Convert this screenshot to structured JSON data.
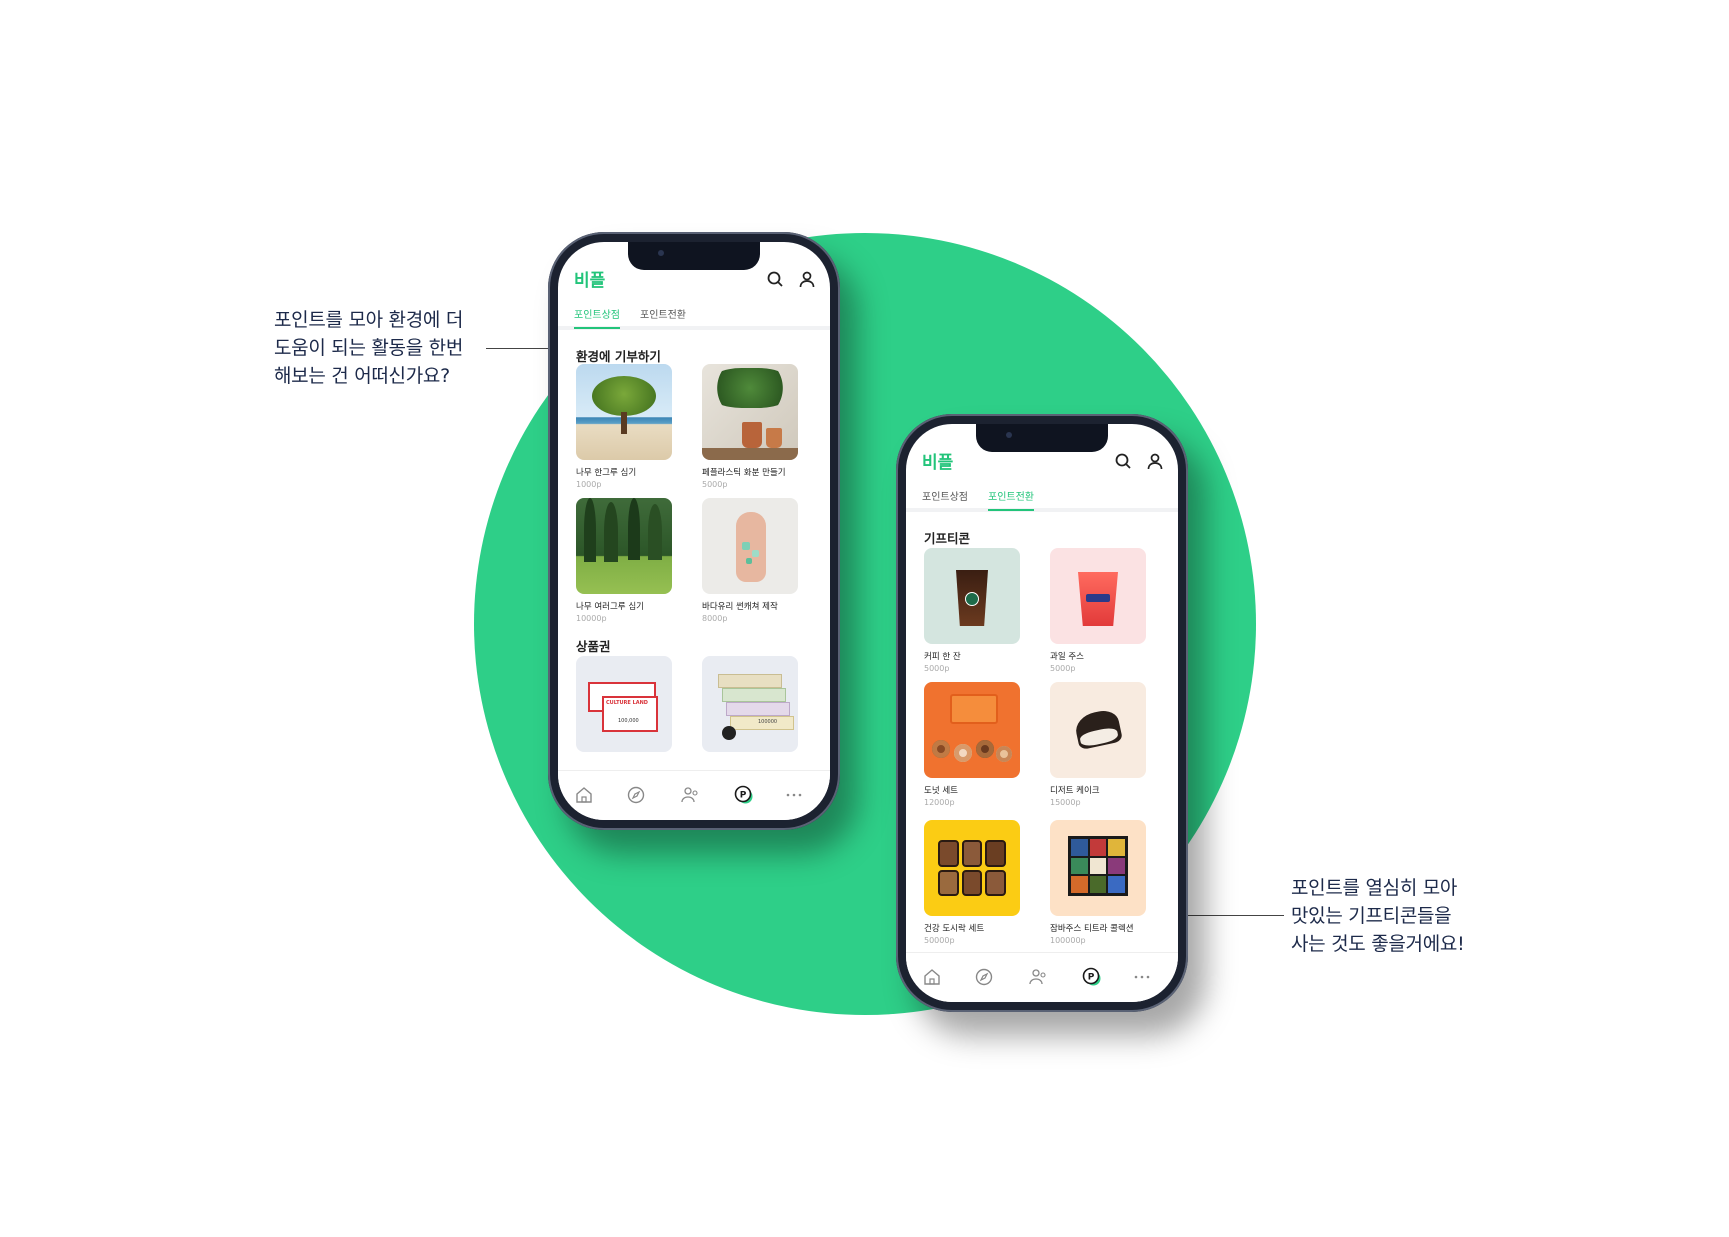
{
  "callouts": {
    "left": "포인트를 모아 환경에 더\n도움이 되는 활동을 한번\n해보는 건 어떠신가요?",
    "right": "포인트를 열심히 모아\n맛있는 기프티콘들을\n사는 것도 좋을거에요!"
  },
  "colors": {
    "accent": "#22c47a",
    "circle": "#2ecf88"
  },
  "app": {
    "logo": "비플"
  },
  "tabs": [
    "포인트상점",
    "포인트전환"
  ],
  "phone1": {
    "active_tab": 0,
    "section1": "환경에 기부하기",
    "section2": "상품권",
    "items": [
      {
        "name": "나무 한그루 심기",
        "price": "1000p",
        "icon": "tree-photo"
      },
      {
        "name": "페플라스틱 화분 만들기",
        "price": "5000p",
        "icon": "plant-pots-photo"
      },
      {
        "name": "나무 여러그루 심기",
        "price": "10000p",
        "icon": "forest-photo"
      },
      {
        "name": "바다유리 썬캐쳐 제작",
        "price": "8000p",
        "icon": "sea-glass-photo"
      }
    ],
    "vouchers": [
      {
        "icon": "culture-land-voucher",
        "text": "CULTURE LAND",
        "amount": "100,000"
      },
      {
        "icon": "money-voucher",
        "text": "",
        "amount": "100000"
      }
    ]
  },
  "phone2": {
    "active_tab": 1,
    "section1": "기프티콘",
    "items": [
      {
        "name": "커피 한 잔",
        "price": "5000p",
        "icon": "coffee-photo"
      },
      {
        "name": "과일 주스",
        "price": "5000p",
        "icon": "juice-photo"
      },
      {
        "name": "도넛 세트",
        "price": "12000p",
        "icon": "donut-photo"
      },
      {
        "name": "디저트 케이크",
        "price": "15000p",
        "icon": "cake-photo"
      },
      {
        "name": "건강 도시락 세트",
        "price": "50000p",
        "icon": "lunchbox-photo"
      },
      {
        "name": "잠바주스 티트라 콜렉션",
        "price": "100000p",
        "icon": "tea-collection-photo"
      }
    ]
  },
  "nav_icons": [
    "home-icon",
    "compass-icon",
    "people-icon",
    "point-icon",
    "more-icon"
  ]
}
